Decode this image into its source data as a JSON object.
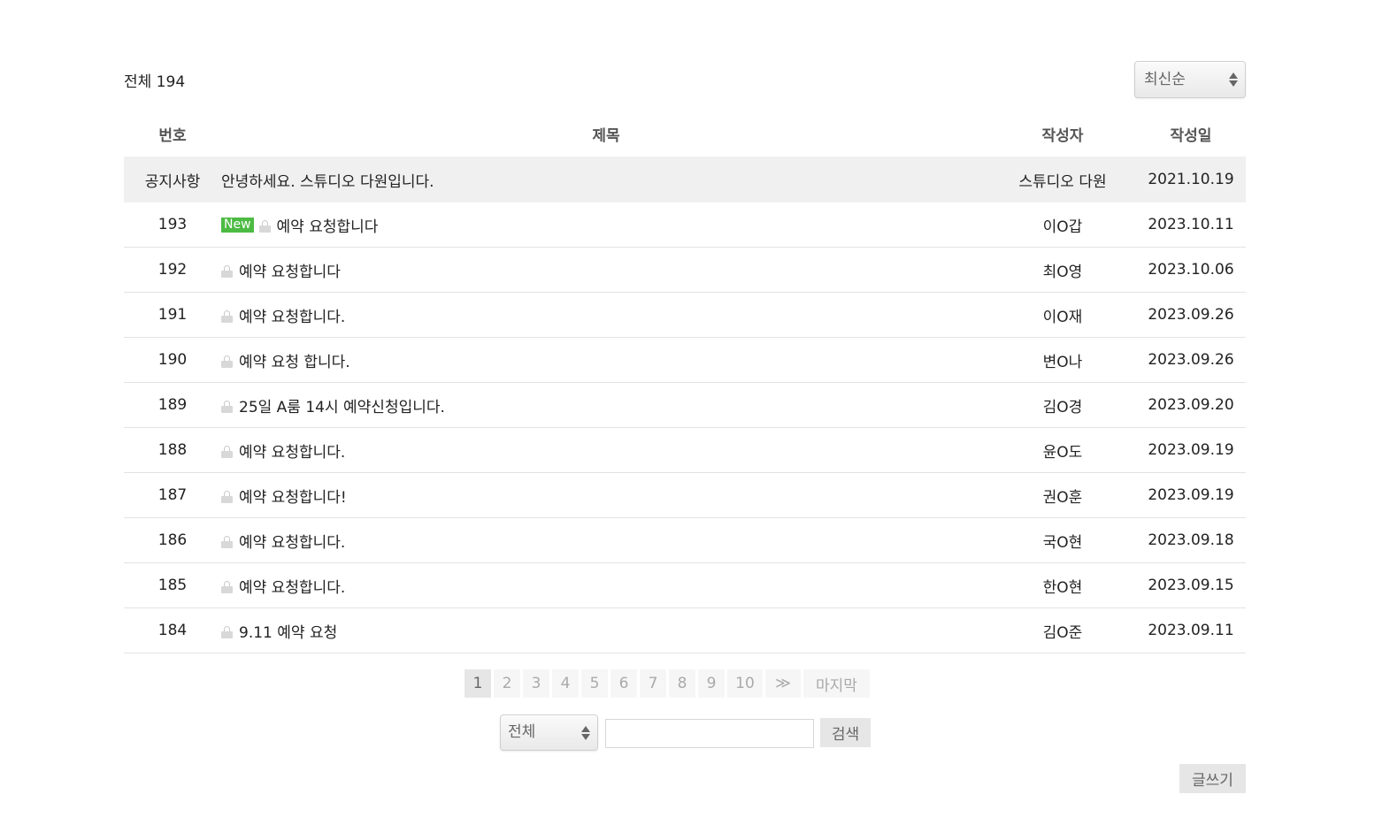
{
  "header": {
    "total_label": "전체 194",
    "sort": {
      "selected": "최신순"
    }
  },
  "columns": {
    "number": "번호",
    "title": "제목",
    "author": "작성자",
    "date": "작성일"
  },
  "notice": {
    "number": "공지사항",
    "title": "안녕하세요. 스튜디오 다원입니다.",
    "author": "스튜디오 다원",
    "date": "2021.10.19"
  },
  "posts": [
    {
      "number": "193",
      "badge": "New",
      "title": "예약 요청합니다",
      "author": "이O갑",
      "date": "2023.10.11"
    },
    {
      "number": "192",
      "title": "예약 요청합니다",
      "author": "최O영",
      "date": "2023.10.06"
    },
    {
      "number": "191",
      "title": "예약 요청합니다.",
      "author": "이O재",
      "date": "2023.09.26"
    },
    {
      "number": "190",
      "title": "예약 요청 합니다.",
      "author": "변O나",
      "date": "2023.09.26"
    },
    {
      "number": "189",
      "title": "25일 A룸 14시 예약신청입니다.",
      "author": "김O경",
      "date": "2023.09.20"
    },
    {
      "number": "188",
      "title": "예약 요청합니다.",
      "author": "윤O도",
      "date": "2023.09.19"
    },
    {
      "number": "187",
      "title": "예약 요청합니다!",
      "author": "권O훈",
      "date": "2023.09.19"
    },
    {
      "number": "186",
      "title": "예약 요청합니다.",
      "author": "국O현",
      "date": "2023.09.18"
    },
    {
      "number": "185",
      "title": "예약 요청합니다.",
      "author": "한O현",
      "date": "2023.09.15"
    },
    {
      "number": "184",
      "title": "9.11 예약 요청",
      "author": "김O준",
      "date": "2023.09.11"
    }
  ],
  "pagination": {
    "pages": [
      "1",
      "2",
      "3",
      "4",
      "5",
      "6",
      "7",
      "8",
      "9",
      "10"
    ],
    "current": "1",
    "next": "≫",
    "last": "마지막"
  },
  "search": {
    "scope_selected": "전체",
    "query": "",
    "button": "검색"
  },
  "write_button": "글쓰기",
  "colors": {
    "new_badge": "#4cbb43",
    "notice_row": "#f0f0f0",
    "button_gray": "#e6e6e6"
  }
}
